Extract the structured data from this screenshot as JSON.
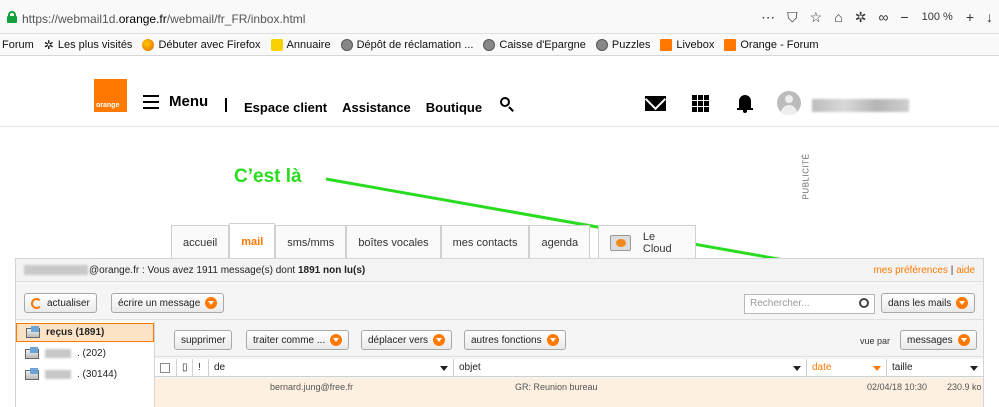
{
  "browser": {
    "url_prefix": "https://webmail1d.",
    "url_domain": "orange.fr",
    "url_suffix": "/webmail/fr_FR/inbox.html",
    "zoom": "100 %",
    "bookmarks": [
      {
        "label": "Forum",
        "icon": ""
      },
      {
        "label": "Les plus visités",
        "icon": "gear-icon"
      },
      {
        "label": "Débuter avec Firefox",
        "icon": "firefox-icon"
      },
      {
        "label": "Annuaire",
        "icon": "smiley-icon"
      },
      {
        "label": "Dépôt de réclamation ...",
        "icon": "globe-icon"
      },
      {
        "label": "Caisse d'Epargne",
        "icon": "globe-icon"
      },
      {
        "label": "Puzzles",
        "icon": "globe-icon"
      },
      {
        "label": "Livebox",
        "icon": "orange-icon"
      },
      {
        "label": "Orange - Forum",
        "icon": "orange-icon"
      }
    ]
  },
  "header": {
    "logo_text": "orange",
    "menu_label": "Menu",
    "nav": [
      "Espace client",
      "Assistance",
      "Boutique"
    ]
  },
  "annotation": {
    "text": "C’est là",
    "color": "#29dc1f"
  },
  "ad": {
    "label": "PUBLICITÉ"
  },
  "tabs": [
    {
      "label": "accueil",
      "active": false
    },
    {
      "label": "mail",
      "active": true
    },
    {
      "label": "sms/mms",
      "active": false
    },
    {
      "label": "boîtes vocales",
      "active": false
    },
    {
      "label": "mes contacts",
      "active": false
    },
    {
      "label": "agenda",
      "active": false
    },
    {
      "label": "Le Cloud",
      "active": false
    }
  ],
  "info": {
    "email_suffix": "@orange.fr : Vous avez 1911 message(s) dont",
    "unread": "1891 non lu(s)",
    "prefs_link": "mes préférences",
    "help_link": "aide"
  },
  "toolbar1": {
    "refresh": "actualiser",
    "compose": "écrire un message",
    "search_placeholder": "Rechercher...",
    "search_scope": "dans les mails"
  },
  "folders": [
    {
      "label": "reçus (1891)",
      "active": true
    },
    {
      "label": ". (202)",
      "active": false
    },
    {
      "label": ". (30144)",
      "active": false
    }
  ],
  "toolbar2": {
    "delete": "supprimer",
    "mark_as": "traiter comme ...",
    "move_to": "déplacer vers",
    "other": "autres fonctions",
    "view_by_label": "vue par",
    "view_by_value": "messages"
  },
  "list_header": {
    "from": "de",
    "subject": "objet",
    "date": "date",
    "size": "taille"
  },
  "row": {
    "from": "bernard.jung@free.fr",
    "subject": "GR: Reunion bureau",
    "date": "02/04/18 10:30",
    "size": "230.9 ko"
  },
  "colors": {
    "brand": "#ff7900",
    "annotation": "#29dc1f"
  }
}
